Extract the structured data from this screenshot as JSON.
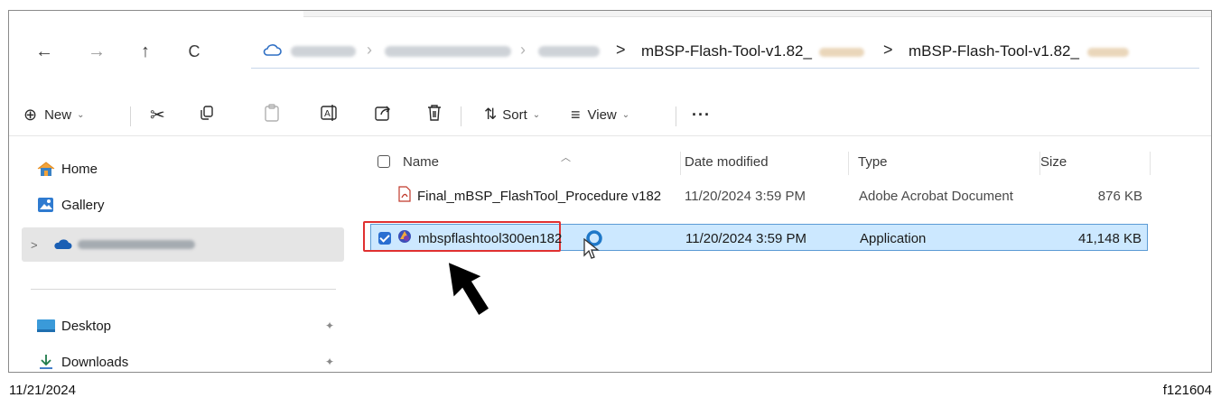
{
  "nav": {
    "back_icon": "←",
    "forward_icon": "→",
    "up_icon": "↑",
    "refresh_icon": "C"
  },
  "address": {
    "crumbs": [
      "mBSP-Flash-Tool-v1.82_",
      "mBSP-Flash-Tool-v1.82_"
    ],
    "separator": ">"
  },
  "toolbar": {
    "new_label": "New",
    "sort_label": "Sort",
    "view_label": "View",
    "more_label": "···",
    "plus_icon": "⊕",
    "sort_icon": "⇅",
    "view_icon": "≡"
  },
  "sidebar": {
    "items": [
      {
        "label": "Home",
        "icon": "home-icon"
      },
      {
        "label": "Gallery",
        "icon": "gallery-icon"
      },
      {
        "label": "",
        "icon": "onedrive-icon"
      },
      {
        "label": "Desktop",
        "icon": "desktop-icon"
      },
      {
        "label": "Downloads",
        "icon": "downloads-icon"
      }
    ],
    "pin_glyph": "✦",
    "expand_glyph": ">"
  },
  "list": {
    "columns": [
      "Name",
      "Date modified",
      "Type",
      "Size"
    ],
    "rows": [
      {
        "name": "Final_mBSP_FlashTool_Procedure v182",
        "date": "11/20/2024 3:59 PM",
        "type": "Adobe Acrobat Document",
        "size": "876 KB",
        "icon": "pdf-icon",
        "selected": false
      },
      {
        "name": "mbspflashtool300en182",
        "date": "11/20/2024 3:59 PM",
        "type": "Application",
        "size": "41,148 KB",
        "icon": "application-icon",
        "selected": true
      }
    ]
  },
  "footer": {
    "date": "11/21/2024",
    "figure_id": "f121604"
  },
  "colors": {
    "selection_bg": "#cce8ff",
    "selection_border": "#5b9bd5",
    "highlight_red": "#e03030",
    "accent_blue": "#2a6fd1"
  }
}
